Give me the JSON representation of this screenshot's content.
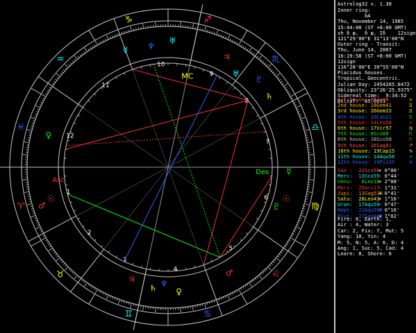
{
  "window": {
    "title": "Astrolog32 v. 1.30"
  },
  "panel": {
    "header_lines": [
      "Inner ring:",
      "         bA",
      "Thu, November 14, 1985",
      "15:44:00 (ST +8:00 GMT)",
      "sh δ ψ,  δ ψ, Iδ    12sign",
      "121°29'00\"E 31°13'00\"N",
      "Outer ring - Transit:",
      "Thu, June 14, 2007",
      "16:19:58 (ST +8:00 GMT)",
      "12sign",
      "116°28'00\"E 39°55'00\"N",
      "Placidus houses.",
      "Tropical, Geocentric.",
      "Julian Day: 2454265.8472",
      "Obliquity: 23°26'25.9375\"",
      "Sidereal time:  9:34:52",
      "DeltaT:  65.0051"
    ],
    "houses": [
      {
        "label": "1st house:",
        "value": "8Tau08",
        "color": "#ff5050",
        "sym": "♉",
        "sym_color": "#ff9900"
      },
      {
        "label": "2nd house:",
        "value": "18Gem41",
        "color": "#ffb000",
        "sym": "♊",
        "sym_color": "#ffff00"
      },
      {
        "label": "3rd house:",
        "value": "26Gem15",
        "color": "#ffff00",
        "sym": "♊",
        "sym_color": "#ffff00"
      },
      {
        "label": "4th house:",
        "value": "10Can21",
        "color": "#3060ff",
        "sym": "♋",
        "sym_color": "#00ff00"
      },
      {
        "label": "5th house:",
        "value": "14Leo58",
        "color": "#ff3030",
        "sym": "♌",
        "sym_color": "#ff3030"
      },
      {
        "label": "6th house:",
        "value": "17Vir57",
        "color": "#ffff00",
        "sym": "♍",
        "sym_color": "#ffff00"
      },
      {
        "label": "7th house:",
        "value": "0Sco00",
        "color": "#00ff00",
        "sym": "♏",
        "sym_color": "#00ff00"
      },
      {
        "label": "8th house:",
        "value": "18Sco58",
        "color": "#c0c0c0",
        "sym": "♏",
        "sym_color": "#ff3030"
      },
      {
        "label": "9th house:",
        "value": "26Sag01",
        "color": "#ff5050",
        "sym": "♐",
        "sym_color": "#ff9900"
      },
      {
        "label": "10th house:",
        "value": "19Cap15",
        "color": "#ffff00",
        "sym": "♑",
        "sym_color": "#ffff00"
      },
      {
        "label": "11th house:",
        "value": "14Aqu58",
        "color": "#00ffff",
        "sym": "♒",
        "sym_color": "#00ffff"
      },
      {
        "label": "12th house:",
        "value": "19Pis35",
        "color": "#3060ff",
        "sym": "♓",
        "sym_color": "#3060ff"
      }
    ],
    "planets": [
      {
        "label": "Sun :  22Sco56",
        "value": "+ 0°00'",
        "color": "#ff5050"
      },
      {
        "label": "Merc:  13Sco55",
        "value": "- 0°44'",
        "color": "#00ffff"
      },
      {
        "label": "Venu:   8Leo18",
        "value": "+ 2°08'",
        "color": "#00ff00"
      },
      {
        "label": "Mars:  25Ari17",
        "value": "- 1°31'",
        "color": "#ff3030"
      },
      {
        "label": "Jupi:  13Sag51R",
        "value": "+ 0°41'",
        "color": "#ff9900"
      },
      {
        "label": "Satu:  28Leo43",
        "value": "+ 1°16'",
        "color": "#ffff00"
      },
      {
        "label": "Uran:  17Aqu59",
        "value": "- 0°47'",
        "color": "#00ffff"
      },
      {
        "label": "Nept:  21Aqu56R",
        "value": "- 0°16'",
        "color": "#3060ff"
      },
      {
        "label": "Plut:  27Sag46R",
        "value": "+ 7°02'",
        "color": "#3060ff"
      }
    ],
    "stats": [
      "Fire: 6, Earth: 1,",
      "Air : 4, Water: 3",
      "Car: 2, Fix: 7, Mut: 5",
      "Yang: 10, Yin: 4",
      "M: 5, N: 5, A: 6, D: 4",
      "Ang: 1, Suc: 5, Cad: 4",
      "Learn: 8, Shore: 6"
    ]
  },
  "wheel": {
    "colors": {
      "ring": "#c8c8c8",
      "fire": "#ff3030",
      "earth": "#ffff00",
      "air": "#00ffff",
      "water": "#3060ff",
      "green": "#00ff00"
    },
    "signs": [
      {
        "glyph": "♈",
        "color": "#ff3030",
        "icon": "aries-icon"
      },
      {
        "glyph": "♉",
        "color": "#ffff00",
        "icon": "taurus-icon"
      },
      {
        "glyph": "♊",
        "color": "#00ffff",
        "icon": "gemini-icon"
      },
      {
        "glyph": "♋",
        "color": "#3060ff",
        "icon": "cancer-icon"
      },
      {
        "glyph": "♌",
        "color": "#ff3030",
        "icon": "leo-icon"
      },
      {
        "glyph": "♍",
        "color": "#ffff00",
        "icon": "virgo-icon"
      },
      {
        "glyph": "♎",
        "color": "#00ffff",
        "icon": "libra-icon"
      },
      {
        "glyph": "♏",
        "color": "#3060ff",
        "icon": "scorpio-icon"
      },
      {
        "glyph": "♐",
        "color": "#ff3030",
        "icon": "sagittarius-icon"
      },
      {
        "glyph": "♑",
        "color": "#ffff00",
        "icon": "capricorn-icon"
      },
      {
        "glyph": "♒",
        "color": "#00ffff",
        "icon": "aquarius-icon"
      },
      {
        "glyph": "♓",
        "color": "#3060ff",
        "icon": "pisces-icon"
      }
    ],
    "house_numbers": [
      "1",
      "2",
      "3",
      "4",
      "5",
      "6",
      "7",
      "8",
      "9",
      "10",
      "11",
      "12"
    ],
    "asc_label": "Asc",
    "mc_label": "MC",
    "des_label": "Des",
    "ic_label": "IC"
  }
}
